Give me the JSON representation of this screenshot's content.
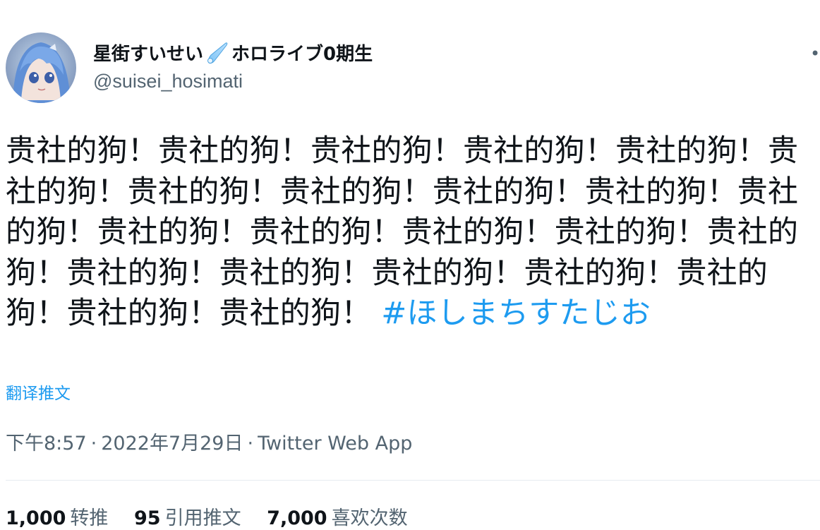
{
  "tweet": {
    "author": {
      "display_name_part1": "星街すいせい",
      "display_name_part2": "ホロライブ0期生",
      "handle": "@suisei_hosimati"
    },
    "text": "贵社的狗！贵社的狗！贵社的狗！贵社的狗！贵社的狗！贵社的狗！贵社的狗！贵社的狗！贵社的狗！贵社的狗！贵社的狗！贵社的狗！贵社的狗！贵社的狗！贵社的狗！贵社的狗！贵社的狗！贵社的狗！贵社的狗！贵社的狗！贵社的狗！贵社的狗！贵社的狗！",
    "hashtag": "#ほしまちすたじお",
    "translate_label": "翻译推文",
    "meta": {
      "time": "下午8:57",
      "date": "2022年7月29日",
      "source": "Twitter Web App",
      "separator": "·"
    },
    "stats": [
      {
        "count": "1,000",
        "label": "转推"
      },
      {
        "count": "95",
        "label": "引用推文"
      },
      {
        "count": "7,000",
        "label": "喜欢次数"
      }
    ]
  },
  "colors": {
    "accent": "#1d9bf0",
    "secondary_text": "#536471",
    "primary_text": "#0f1419"
  },
  "icons": {
    "comet": "comet-icon",
    "more": "more-icon"
  }
}
